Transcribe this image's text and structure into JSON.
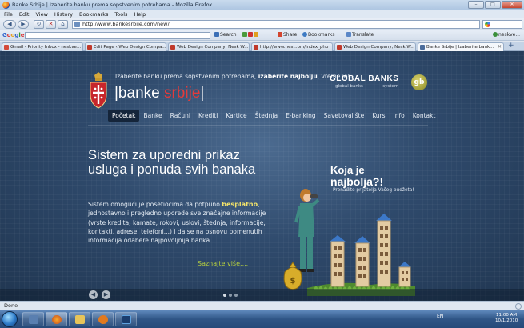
{
  "window": {
    "title": "Banke Srbije | Izaberite banku prema sopstvenim potrebama - Mozilla Firefox",
    "minimize": "–",
    "maximize": "□",
    "close": "✕"
  },
  "menu": [
    "File",
    "Edit",
    "View",
    "History",
    "Bookmarks",
    "Tools",
    "Help"
  ],
  "nav": {
    "back": "◀",
    "forward": "▶",
    "reload": "↻",
    "stop": "✕",
    "home": "⌂",
    "url": "http://www.bankesrbije.com/new/"
  },
  "google_toolbar": {
    "logo": [
      "G",
      "o",
      "o",
      "g",
      "l",
      "e"
    ],
    "search_label": "Search",
    "share_label": "Share",
    "bookmarks_label": "Bookmarks",
    "translate_label": "Translate",
    "user_label": "neskve..."
  },
  "tabs": [
    {
      "label": "Gmail - Priority Inbox - neskve...",
      "color": "#d44a3a"
    },
    {
      "label": "Edit Page ‹ Web Design Compa...",
      "color": "#c0392b"
    },
    {
      "label": "Web Design Company, Nesk W...",
      "color": "#c0392b"
    },
    {
      "label": "http://www.nes...om/index_php",
      "color": "#c0392b"
    },
    {
      "label": "Web Design Company, Nesk W...",
      "color": "#c0392b"
    },
    {
      "label": "Banke Srbije | Izaberite bank...",
      "color": "#4a6c9b"
    }
  ],
  "site": {
    "tagline_pre": "Izaberite banku prema sopstvenim potrebama, ",
    "tagline_bold": "izaberite najbolju",
    "tagline_post": ", vreme je!",
    "logo_white": "|banke ",
    "logo_red": "srbije",
    "logo_end": "|",
    "gb_name": "GLOBAL BANKS",
    "gb_sub_pre": "global banks",
    "gb_sub_mid": " ············ ",
    "gb_sub_post": "system",
    "gb_badge": "gb"
  },
  "main_nav": [
    "Početak",
    "Banke",
    "Računi",
    "Krediti",
    "Kartice",
    "Štednja",
    "E-banking",
    "Savetovalište",
    "Kurs",
    "Info",
    "Kontakt"
  ],
  "hero": {
    "title": "Sistem za uporedni prikaz usluga i ponuda svih banaka",
    "body_pre": "Sistem omogućuje posetiocima da potpuno ",
    "body_hl": "besplatno",
    "body_post": ", jednostavno i pregledno uporede sve značajne informacije (vrste kredita, kamate, rokovi, uslovi, štednja, informacije, kontakti, adrese, telefoni...) i da se na osnovu pomenutih informacija odabere najpovoljnija banka.",
    "read_more": "Saznajte više...."
  },
  "promo": {
    "line1": "Koja je",
    "line2": "najbolja?!",
    "sub": "Pronađite prijatelja Vašeg budžeta!"
  },
  "slider": {
    "prev": "◀",
    "next": "▶"
  },
  "status": "Done",
  "taskbar": {
    "lang": "EN",
    "time": "11:00 AM",
    "date": "10/1/2010"
  }
}
